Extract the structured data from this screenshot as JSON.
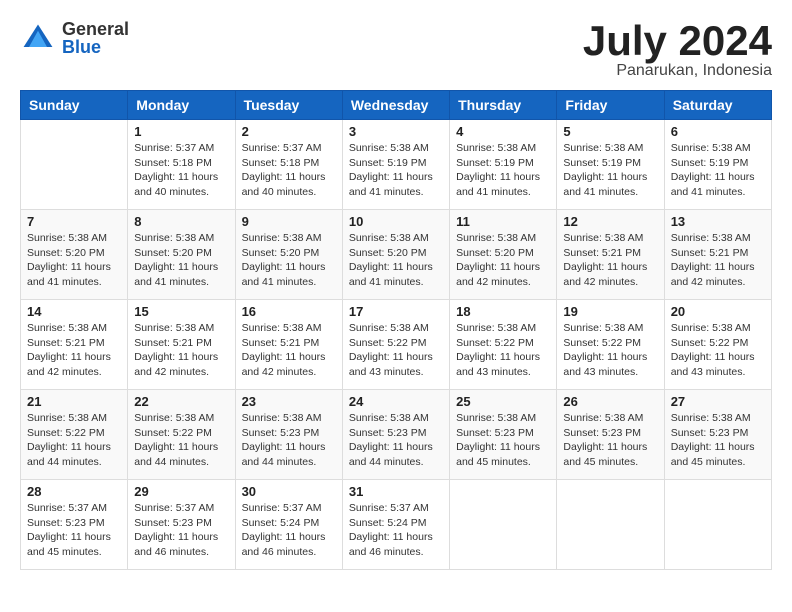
{
  "logo": {
    "general": "General",
    "blue": "Blue"
  },
  "header": {
    "title": "July 2024",
    "subtitle": "Panarukan, Indonesia"
  },
  "weekdays": [
    "Sunday",
    "Monday",
    "Tuesday",
    "Wednesday",
    "Thursday",
    "Friday",
    "Saturday"
  ],
  "weeks": [
    [
      {
        "day": "",
        "sunrise": "",
        "sunset": "",
        "daylight": ""
      },
      {
        "day": "1",
        "sunrise": "Sunrise: 5:37 AM",
        "sunset": "Sunset: 5:18 PM",
        "daylight": "Daylight: 11 hours and 40 minutes."
      },
      {
        "day": "2",
        "sunrise": "Sunrise: 5:37 AM",
        "sunset": "Sunset: 5:18 PM",
        "daylight": "Daylight: 11 hours and 40 minutes."
      },
      {
        "day": "3",
        "sunrise": "Sunrise: 5:38 AM",
        "sunset": "Sunset: 5:19 PM",
        "daylight": "Daylight: 11 hours and 41 minutes."
      },
      {
        "day": "4",
        "sunrise": "Sunrise: 5:38 AM",
        "sunset": "Sunset: 5:19 PM",
        "daylight": "Daylight: 11 hours and 41 minutes."
      },
      {
        "day": "5",
        "sunrise": "Sunrise: 5:38 AM",
        "sunset": "Sunset: 5:19 PM",
        "daylight": "Daylight: 11 hours and 41 minutes."
      },
      {
        "day": "6",
        "sunrise": "Sunrise: 5:38 AM",
        "sunset": "Sunset: 5:19 PM",
        "daylight": "Daylight: 11 hours and 41 minutes."
      }
    ],
    [
      {
        "day": "7",
        "sunrise": "Sunrise: 5:38 AM",
        "sunset": "Sunset: 5:20 PM",
        "daylight": "Daylight: 11 hours and 41 minutes."
      },
      {
        "day": "8",
        "sunrise": "Sunrise: 5:38 AM",
        "sunset": "Sunset: 5:20 PM",
        "daylight": "Daylight: 11 hours and 41 minutes."
      },
      {
        "day": "9",
        "sunrise": "Sunrise: 5:38 AM",
        "sunset": "Sunset: 5:20 PM",
        "daylight": "Daylight: 11 hours and 41 minutes."
      },
      {
        "day": "10",
        "sunrise": "Sunrise: 5:38 AM",
        "sunset": "Sunset: 5:20 PM",
        "daylight": "Daylight: 11 hours and 41 minutes."
      },
      {
        "day": "11",
        "sunrise": "Sunrise: 5:38 AM",
        "sunset": "Sunset: 5:20 PM",
        "daylight": "Daylight: 11 hours and 42 minutes."
      },
      {
        "day": "12",
        "sunrise": "Sunrise: 5:38 AM",
        "sunset": "Sunset: 5:21 PM",
        "daylight": "Daylight: 11 hours and 42 minutes."
      },
      {
        "day": "13",
        "sunrise": "Sunrise: 5:38 AM",
        "sunset": "Sunset: 5:21 PM",
        "daylight": "Daylight: 11 hours and 42 minutes."
      }
    ],
    [
      {
        "day": "14",
        "sunrise": "Sunrise: 5:38 AM",
        "sunset": "Sunset: 5:21 PM",
        "daylight": "Daylight: 11 hours and 42 minutes."
      },
      {
        "day": "15",
        "sunrise": "Sunrise: 5:38 AM",
        "sunset": "Sunset: 5:21 PM",
        "daylight": "Daylight: 11 hours and 42 minutes."
      },
      {
        "day": "16",
        "sunrise": "Sunrise: 5:38 AM",
        "sunset": "Sunset: 5:21 PM",
        "daylight": "Daylight: 11 hours and 42 minutes."
      },
      {
        "day": "17",
        "sunrise": "Sunrise: 5:38 AM",
        "sunset": "Sunset: 5:22 PM",
        "daylight": "Daylight: 11 hours and 43 minutes."
      },
      {
        "day": "18",
        "sunrise": "Sunrise: 5:38 AM",
        "sunset": "Sunset: 5:22 PM",
        "daylight": "Daylight: 11 hours and 43 minutes."
      },
      {
        "day": "19",
        "sunrise": "Sunrise: 5:38 AM",
        "sunset": "Sunset: 5:22 PM",
        "daylight": "Daylight: 11 hours and 43 minutes."
      },
      {
        "day": "20",
        "sunrise": "Sunrise: 5:38 AM",
        "sunset": "Sunset: 5:22 PM",
        "daylight": "Daylight: 11 hours and 43 minutes."
      }
    ],
    [
      {
        "day": "21",
        "sunrise": "Sunrise: 5:38 AM",
        "sunset": "Sunset: 5:22 PM",
        "daylight": "Daylight: 11 hours and 44 minutes."
      },
      {
        "day": "22",
        "sunrise": "Sunrise: 5:38 AM",
        "sunset": "Sunset: 5:22 PM",
        "daylight": "Daylight: 11 hours and 44 minutes."
      },
      {
        "day": "23",
        "sunrise": "Sunrise: 5:38 AM",
        "sunset": "Sunset: 5:23 PM",
        "daylight": "Daylight: 11 hours and 44 minutes."
      },
      {
        "day": "24",
        "sunrise": "Sunrise: 5:38 AM",
        "sunset": "Sunset: 5:23 PM",
        "daylight": "Daylight: 11 hours and 44 minutes."
      },
      {
        "day": "25",
        "sunrise": "Sunrise: 5:38 AM",
        "sunset": "Sunset: 5:23 PM",
        "daylight": "Daylight: 11 hours and 45 minutes."
      },
      {
        "day": "26",
        "sunrise": "Sunrise: 5:38 AM",
        "sunset": "Sunset: 5:23 PM",
        "daylight": "Daylight: 11 hours and 45 minutes."
      },
      {
        "day": "27",
        "sunrise": "Sunrise: 5:38 AM",
        "sunset": "Sunset: 5:23 PM",
        "daylight": "Daylight: 11 hours and 45 minutes."
      }
    ],
    [
      {
        "day": "28",
        "sunrise": "Sunrise: 5:37 AM",
        "sunset": "Sunset: 5:23 PM",
        "daylight": "Daylight: 11 hours and 45 minutes."
      },
      {
        "day": "29",
        "sunrise": "Sunrise: 5:37 AM",
        "sunset": "Sunset: 5:23 PM",
        "daylight": "Daylight: 11 hours and 46 minutes."
      },
      {
        "day": "30",
        "sunrise": "Sunrise: 5:37 AM",
        "sunset": "Sunset: 5:24 PM",
        "daylight": "Daylight: 11 hours and 46 minutes."
      },
      {
        "day": "31",
        "sunrise": "Sunrise: 5:37 AM",
        "sunset": "Sunset: 5:24 PM",
        "daylight": "Daylight: 11 hours and 46 minutes."
      },
      {
        "day": "",
        "sunrise": "",
        "sunset": "",
        "daylight": ""
      },
      {
        "day": "",
        "sunrise": "",
        "sunset": "",
        "daylight": ""
      },
      {
        "day": "",
        "sunrise": "",
        "sunset": "",
        "daylight": ""
      }
    ]
  ]
}
